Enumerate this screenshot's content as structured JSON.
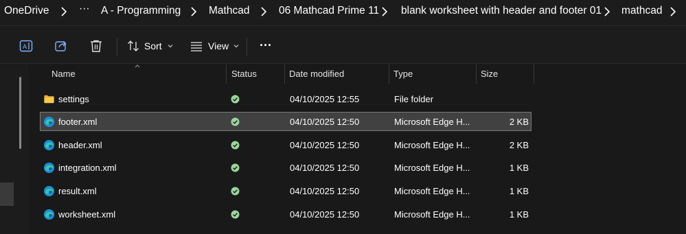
{
  "breadcrumb": {
    "items": [
      {
        "label": "OneDrive"
      },
      {
        "label": "···"
      },
      {
        "label": "A - Programming"
      },
      {
        "label": "Mathcad"
      },
      {
        "label": "06 Mathcad Prime 11"
      },
      {
        "label": "blank worksheet with header and footer 01"
      },
      {
        "label": "mathcad"
      }
    ]
  },
  "toolbar": {
    "rename_icon": "rename-icon",
    "share_icon": "share-icon",
    "delete_icon": "delete-icon",
    "sort_label": "Sort",
    "view_label": "View",
    "more_label": "···"
  },
  "columns": {
    "name": "Name",
    "status": "Status",
    "date_modified": "Date modified",
    "type": "Type",
    "size": "Size"
  },
  "files": [
    {
      "name": "settings",
      "date": "04/10/2025 12:55",
      "type": "File folder",
      "size": "",
      "icon": "folder-icon",
      "selected": false
    },
    {
      "name": "footer.xml",
      "date": "04/10/2025 12:50",
      "type": "Microsoft Edge H...",
      "size": "2 KB",
      "icon": "edge-icon",
      "selected": true
    },
    {
      "name": "header.xml",
      "date": "04/10/2025 12:50",
      "type": "Microsoft Edge H...",
      "size": "2 KB",
      "icon": "edge-icon",
      "selected": false
    },
    {
      "name": "integration.xml",
      "date": "04/10/2025 12:50",
      "type": "Microsoft Edge H...",
      "size": "1 KB",
      "icon": "edge-icon",
      "selected": false
    },
    {
      "name": "result.xml",
      "date": "04/10/2025 12:50",
      "type": "Microsoft Edge H...",
      "size": "1 KB",
      "icon": "edge-icon",
      "selected": false
    },
    {
      "name": "worksheet.xml",
      "date": "04/10/2025 12:50",
      "type": "Microsoft Edge H...",
      "size": "1 KB",
      "icon": "edge-icon",
      "selected": false
    }
  ],
  "colors": {
    "background": "#191919",
    "selected_row": "#414141",
    "status_green": "#9bd49b",
    "folder_yellow": "#f6c94a"
  }
}
